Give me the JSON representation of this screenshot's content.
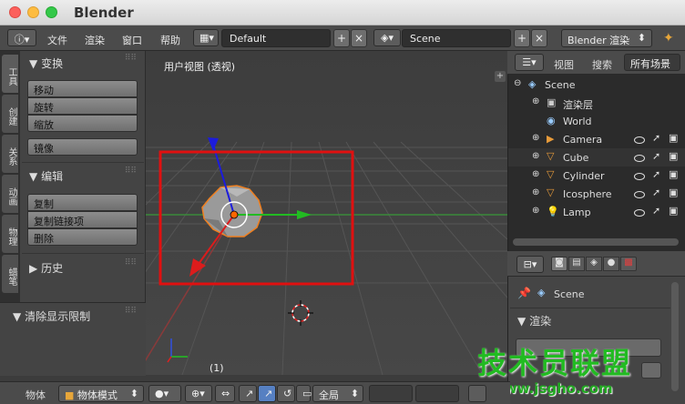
{
  "window": {
    "title": "Blender"
  },
  "header": {
    "menus": [
      "文件",
      "渲染",
      "窗口",
      "帮助"
    ],
    "layout_value": "Default",
    "scene_value": "Scene",
    "render_engine": "Blender 渲染"
  },
  "toolshelf": {
    "tabs": [
      "工具",
      "创建",
      "关系",
      "动画",
      "物理",
      "蜡笔"
    ],
    "transform_title": "变换",
    "transform_buttons": [
      "移动",
      "旋转",
      "缩放"
    ],
    "mirror_button": "镜像",
    "edit_title": "编辑",
    "edit_buttons": [
      "复制",
      "复制链接项",
      "删除"
    ],
    "history_title": "历史",
    "clear_limit": "清除显示限制"
  },
  "viewport": {
    "label": "用户视图 (透视)",
    "frame": "(1)"
  },
  "outliner": {
    "view_label": "视图",
    "search_label": "搜索",
    "filter_value": "所有场景",
    "items": [
      {
        "label": "Scene",
        "depth": 0
      },
      {
        "label": "渲染层",
        "depth": 1
      },
      {
        "label": "World",
        "depth": 1
      },
      {
        "label": "Camera",
        "depth": 1
      },
      {
        "label": "Cube",
        "depth": 1
      },
      {
        "label": "Cylinder",
        "depth": 1
      },
      {
        "label": "Icosphere",
        "depth": 1
      },
      {
        "label": "Lamp",
        "depth": 1
      }
    ]
  },
  "properties": {
    "scene_label": "Scene",
    "render_title": "渲染"
  },
  "footer": {
    "view_label": "物体",
    "mode_value": "物体模式",
    "global_value": "全局"
  },
  "watermark": {
    "text": "技术员联盟",
    "url": "www.jsgho.com"
  },
  "colors": {
    "highlight_box": "#e01010",
    "x_axis": "#e02020",
    "y_axis": "#20c020",
    "z_axis": "#2020e0"
  }
}
